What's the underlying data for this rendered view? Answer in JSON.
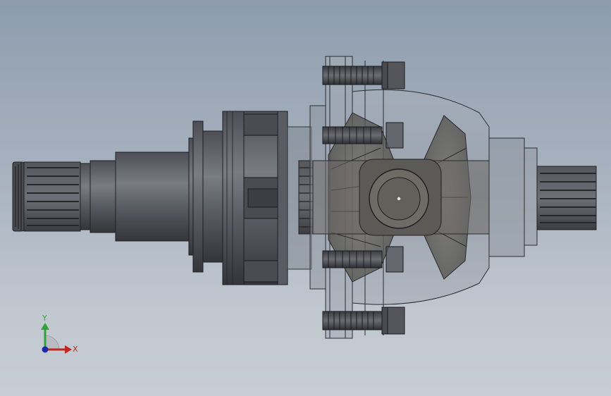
{
  "viewport": {
    "background_top": "#8d9cad",
    "background_bottom": "#c8cdd5"
  },
  "model": {
    "part_color": "#5f6066",
    "part_dark": "#3a3b40",
    "housing_color": "#9aa2ad",
    "gear_color": "#6d6a66"
  },
  "triad": {
    "x_label": "X",
    "y_label": "Y",
    "x_color": "#c0281e",
    "y_color": "#2fa33a",
    "z_color": "#1c2aa8"
  }
}
